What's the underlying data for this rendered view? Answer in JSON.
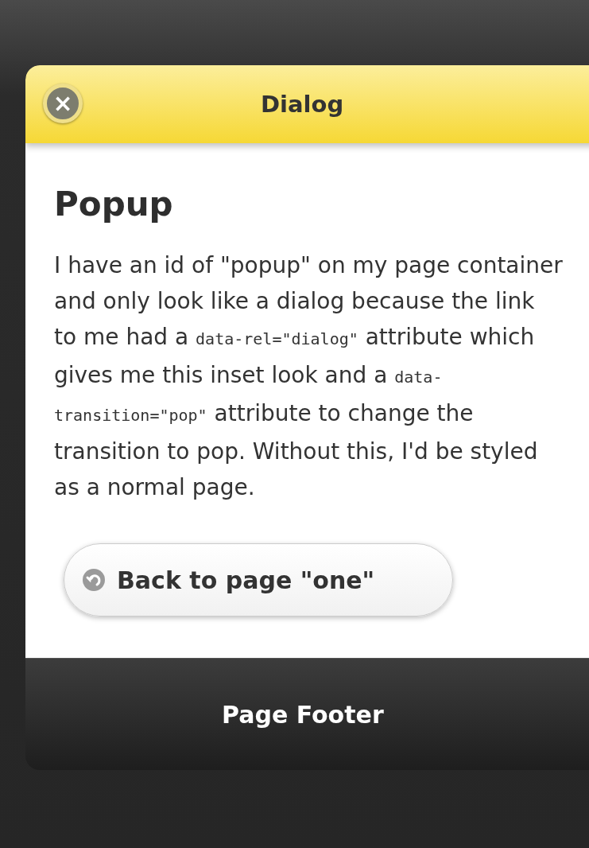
{
  "header": {
    "title": "Dialog",
    "close_icon": "×"
  },
  "content": {
    "heading": "Popup",
    "paragraph": [
      {
        "kind": "text",
        "text": "I have an id of \"popup\" on my page container and only look like a dialog because the link to me had a "
      },
      {
        "kind": "code",
        "text": "data-rel=\"dialog\""
      },
      {
        "kind": "text",
        "text": " attribute which gives me this inset look and a "
      },
      {
        "kind": "code",
        "text": "data-transition=\"pop\""
      },
      {
        "kind": "text",
        "text": " attribute to change the transition to pop. Without this, I'd be styled as a normal page."
      }
    ],
    "button": {
      "label": "Back to page \"one\""
    }
  },
  "footer": {
    "title": "Page Footer"
  }
}
